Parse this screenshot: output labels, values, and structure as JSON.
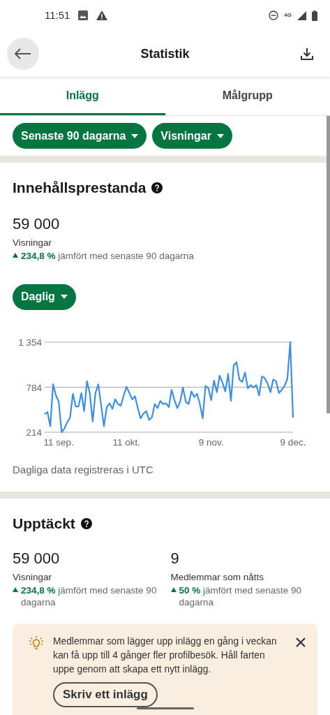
{
  "status_bar": {
    "time": "11:51",
    "network": "4G"
  },
  "app_bar": {
    "title": "Statistik"
  },
  "tabs": [
    {
      "label": "Inlägg",
      "selected": true
    },
    {
      "label": "Målgrupp",
      "selected": false
    }
  ],
  "filters": [
    "Senaste 90 dagarna",
    "Visningar"
  ],
  "performance": {
    "title": "Innehållsprestanda",
    "value": "59 000",
    "label": "Visningar",
    "change": "234,8 %",
    "comparison": "jämfört med senaste 90 dagarna",
    "interval": "Daglig",
    "chart_data": {
      "type": "line",
      "categories": [
        null,
        null,
        null,
        null,
        null,
        "11 sep.",
        null,
        null,
        null,
        null,
        null,
        null,
        null,
        null,
        null,
        null,
        null,
        null,
        null,
        null,
        null,
        null,
        null,
        null,
        null,
        null,
        null,
        null,
        null,
        "11 okt.",
        null,
        null,
        null,
        null,
        null,
        null,
        null,
        null,
        null,
        null,
        null,
        null,
        null,
        null,
        null,
        null,
        null,
        null,
        null,
        null,
        null,
        null,
        null,
        null,
        null,
        null,
        null,
        null,
        null,
        "9 nov.",
        null,
        null,
        null,
        null,
        null,
        null,
        null,
        null,
        null,
        null,
        null,
        null,
        null,
        null,
        null,
        null,
        null,
        null,
        null,
        null,
        null,
        null,
        null,
        null,
        null,
        null,
        null,
        null,
        "9 dec."
      ],
      "series": [
        {
          "color": "#3b8fe6",
          "values": [
            440,
            470,
            290,
            820,
            680,
            600,
            214,
            260,
            340,
            400,
            700,
            540,
            540,
            710,
            480,
            860,
            710,
            350,
            710,
            820,
            560,
            290,
            530,
            580,
            510,
            630,
            570,
            550,
            680,
            790,
            710,
            630,
            670,
            520,
            390,
            450,
            480,
            370,
            400,
            570,
            520,
            610,
            570,
            580,
            530,
            750,
            620,
            520,
            600,
            780,
            600,
            570,
            730,
            660,
            700,
            570,
            390,
            800,
            770,
            620,
            870,
            720,
            930,
            840,
            730,
            950,
            610,
            1060,
            1100,
            880,
            850,
            970,
            770,
            810,
            780,
            810,
            680,
            920,
            900,
            830,
            720,
            880,
            860,
            710,
            750,
            800,
            890,
            1354,
            400
          ]
        }
      ],
      "ylim": [
        214,
        1354
      ],
      "yticks": [
        {
          "value": 214,
          "label": "214"
        },
        {
          "value": 784,
          "label": "784"
        },
        {
          "value": 1354,
          "label": "1 354"
        }
      ]
    },
    "note": "Dagliga data registreras i UTC"
  },
  "discovery": {
    "title": "Upptäckt",
    "metrics": [
      {
        "value": "59 000",
        "label": "Visningar",
        "change": "234,8 %",
        "comparison": "jämfört med senaste 90 dagarna"
      },
      {
        "value": "9",
        "label": "Medlemmar som nåtts",
        "change": "50 %",
        "comparison": "jämfört med senaste 90 dagarna"
      }
    ]
  },
  "tip": {
    "text": "Medlemmar som lägger upp inlägg en gång i veckan kan få upp till 4 gånger fler profilbesök. Håll farten uppe genom att skapa ett nytt inlägg.",
    "button": "Skriv ett inlägg"
  }
}
